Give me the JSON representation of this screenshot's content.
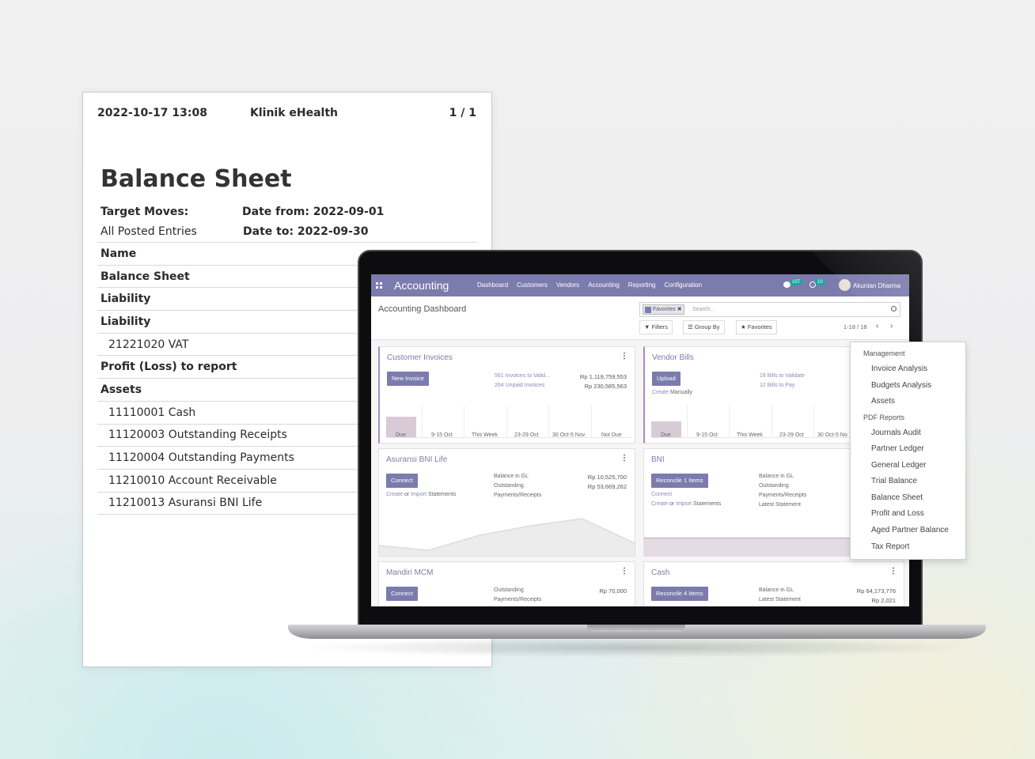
{
  "report": {
    "date": "2022-10-17 13:08",
    "company": "Klinik eHealth",
    "page": "1 / 1",
    "title": "Balance Sheet",
    "target_moves_label": "Target Moves:",
    "target_moves_value": "All Posted Entries",
    "date_from": "Date from: 2022-09-01",
    "date_to": "Date to: 2022-09-30",
    "rows": [
      {
        "label": "Name",
        "bold": true
      },
      {
        "label": "Balance Sheet",
        "bold": true
      },
      {
        "label": "Liability",
        "bold": true
      },
      {
        "label": "Liability",
        "bold": true
      },
      {
        "label": "21221020 VAT",
        "bold": false
      },
      {
        "label": "Profit (Loss) to report",
        "bold": true
      },
      {
        "label": "Assets",
        "bold": true
      },
      {
        "label": "11110001 Cash",
        "bold": false
      },
      {
        "label": "11120003 Outstanding Receipts",
        "bold": false
      },
      {
        "label": "11120004 Outstanding Payments",
        "bold": false
      },
      {
        "label": "11210010 Account Receivable",
        "bold": false
      },
      {
        "label": "11210013 Asuransi BNI Life",
        "bold": false
      }
    ]
  },
  "app": {
    "name": "Accounting",
    "menu": [
      "Dashboard",
      "Customers",
      "Vendors",
      "Accounting",
      "Reporting",
      "Configuration"
    ],
    "messages_badge": "107",
    "activities_badge": "10",
    "user": "Akuntan Dharma",
    "accent": "#7c7bad"
  },
  "control_panel": {
    "title": "Accounting Dashboard",
    "facet": "Favorites",
    "search_placeholder": "Search...",
    "filters": "Filters",
    "group_by": "Group By",
    "favorites": "Favorites",
    "pager": "1-18 / 18"
  },
  "cards": {
    "customer_invoices": {
      "title": "Customer Invoices",
      "button": "New Invoice",
      "stat1_label": "561 Invoices to Valid...",
      "stat1_value": "Rp 1,119,759,553",
      "stat2_label": "264 Unpaid Invoices",
      "stat2_value": "Rp 230,585,563",
      "x_labels": [
        "Due",
        "9-15 Oct",
        "This Week",
        "23-29 Oct",
        "30 Oct-5 Nov",
        "Not Due"
      ]
    },
    "vendor_bills": {
      "title": "Vendor Bills",
      "button": "Upload",
      "create_link": "Create",
      "create_rest": "Manually",
      "stat1_label": "16 Bills to Validate",
      "stat2_label": "12 Bills to Pay",
      "x_labels": [
        "Due",
        "9-15 Oct",
        "This Week",
        "23-29 Oct",
        "30 Oct-5 No"
      ]
    },
    "asuransi": {
      "title": "Asuransi BNI Life",
      "button": "Connect",
      "create": "Create",
      "or": "or",
      "import": "Import",
      "statements": "Statements",
      "bal_label": "Balance in GL",
      "bal_value": "Rp 10,525,700",
      "out_label": "Outstanding",
      "out_label2": "Payments/Receipts",
      "out_value": "Rp 53,669,262"
    },
    "bni": {
      "title": "BNI",
      "button": "Reconcile 1 Items",
      "connect": "Connect",
      "create": "Create",
      "or": "or",
      "import": "Import",
      "statements": "Statements",
      "bal_label": "Balance in GL",
      "out_label": "Outstanding",
      "out_label2": "Payments/Receipts",
      "latest": "Latest Statement"
    },
    "mandiri": {
      "title": "Mandiri MCM",
      "button": "Connect",
      "out_label": "Outstanding",
      "out_label2": "Payments/Receipts",
      "out_value": "Rp 70,000"
    },
    "cash": {
      "title": "Cash",
      "button": "Reconcile 4 Items",
      "bal_label": "Balance in GL",
      "bal_value": "Rp 64,173,776",
      "latest": "Latest Statement",
      "latest_value": "Rp 2,021"
    }
  },
  "dropdown": {
    "management_header": "Management",
    "management": [
      "Invoice Analysis",
      "Budgets Analysis",
      "Assets"
    ],
    "pdf_header": "PDF Reports",
    "pdf": [
      "Journals Audit",
      "Partner Ledger",
      "General Ledger",
      "Trial Balance",
      "Balance Sheet",
      "Profit and Loss",
      "Aged Partner Balance",
      "Tax Report"
    ]
  }
}
